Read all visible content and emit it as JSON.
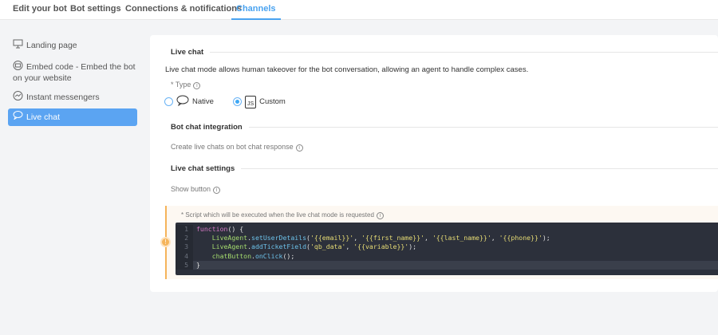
{
  "tabs": [
    "Edit your bot",
    "Bot settings",
    "Connections & notifications",
    "Channels"
  ],
  "sidebar": [
    {
      "label": "Landing page",
      "icon": "monitor-icon"
    },
    {
      "label": "Embed code - Embed the bot on your website",
      "icon": "embed-icon"
    },
    {
      "label": "Instant messengers",
      "icon": "messenger-icon"
    },
    {
      "label": "Live chat",
      "icon": "chat-bubble-icon"
    }
  ],
  "live_chat": {
    "heading": "Live chat",
    "description": "Live chat mode allows human takeover for the bot conversation, allowing an agent to handle complex cases.",
    "type_label": "* Type",
    "options": [
      {
        "label": "Native",
        "selected": false
      },
      {
        "label": "Custom",
        "selected": true,
        "badge": "JS"
      }
    ]
  },
  "integration": {
    "heading": "Bot chat integration",
    "option": "Create live chats on bot chat response"
  },
  "settings": {
    "heading": "Live chat settings",
    "option": "Show button"
  },
  "script": {
    "label": "* Script which will be executed when the live chat mode is requested",
    "lines": [
      {
        "n": "1",
        "tokens": [
          [
            "kw",
            "function"
          ],
          [
            "pl",
            "() {"
          ]
        ]
      },
      {
        "n": "2",
        "tokens": [
          [
            "pl",
            "    "
          ],
          [
            "obj",
            "LiveAgent"
          ],
          [
            "pl",
            "."
          ],
          [
            "fn",
            "setUserDetails"
          ],
          [
            "pl",
            "("
          ],
          [
            "str",
            "'{{email}}'"
          ],
          [
            "pl",
            ", "
          ],
          [
            "str",
            "'{{first_name}}'"
          ],
          [
            "pl",
            ", "
          ],
          [
            "str",
            "'{{last_name}}'"
          ],
          [
            "pl",
            ", "
          ],
          [
            "str",
            "'{{phone}}'"
          ],
          [
            "pl",
            ");"
          ]
        ]
      },
      {
        "n": "3",
        "tokens": [
          [
            "pl",
            "    "
          ],
          [
            "obj",
            "LiveAgent"
          ],
          [
            "pl",
            "."
          ],
          [
            "fn",
            "addTicketField"
          ],
          [
            "pl",
            "("
          ],
          [
            "str",
            "'qb_data'"
          ],
          [
            "pl",
            ", "
          ],
          [
            "str",
            "'{{variable}}'"
          ],
          [
            "pl",
            ");"
          ]
        ]
      },
      {
        "n": "4",
        "tokens": [
          [
            "pl",
            "    "
          ],
          [
            "obj",
            "chatButton"
          ],
          [
            "pl",
            "."
          ],
          [
            "fn",
            "onClick"
          ],
          [
            "pl",
            "();"
          ]
        ]
      },
      {
        "n": "5",
        "tokens": [
          [
            "pl",
            "}"
          ]
        ]
      }
    ]
  },
  "colors": {
    "accent": "#4aa3f0",
    "active_item": "#5ba4f2",
    "warning": "#f5b45a",
    "code_bg": "#2c303b"
  }
}
